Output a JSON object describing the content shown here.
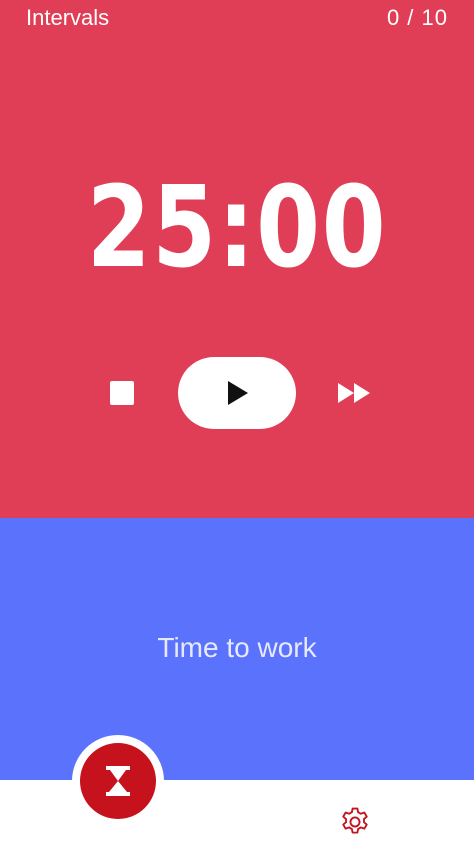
{
  "header": {
    "title": "Intervals",
    "progress": "0 / 10"
  },
  "timer": {
    "display": "25:00"
  },
  "controls": {
    "stop_icon": "stop-icon",
    "play_icon": "play-icon",
    "skip_icon": "fast-forward-icon"
  },
  "phase": {
    "label": "Time to work"
  },
  "nav": {
    "timer_icon": "hourglass-icon",
    "settings_icon": "gear-icon"
  },
  "colors": {
    "work_panel": "#e03d56",
    "phase_panel": "#5b72fd",
    "fab": "#c5121d",
    "settings_icon": "#c5121d"
  }
}
